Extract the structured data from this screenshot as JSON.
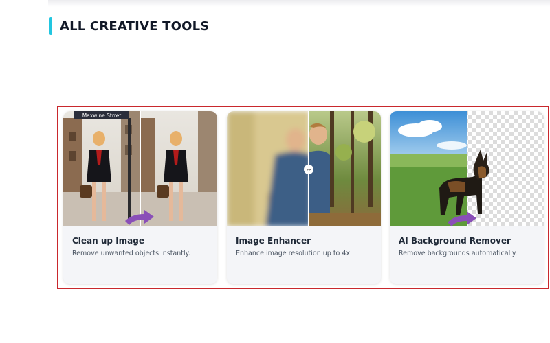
{
  "section": {
    "title": "ALL CREATIVE TOOLS",
    "accent_color": "#22c6e0"
  },
  "highlight_color": "#c9282d",
  "tools": [
    {
      "title": "Clean up Image",
      "description": "Remove unwanted objects instantly.",
      "image_sign_text": "Maxwine Strret",
      "arrow_icon": "curved-arrow-icon"
    },
    {
      "title": "Image Enhancer",
      "description": "Enhance image resolution up to 4x.",
      "handle_icon": "left-right-arrow-icon"
    },
    {
      "title": "AI Background Remover",
      "description": "Remove backgrounds automatically.",
      "arrow_icon": "curved-arrow-icon"
    }
  ],
  "colors": {
    "arrow_purple": "#8a4fb8",
    "card_bg": "#f4f5f8"
  }
}
